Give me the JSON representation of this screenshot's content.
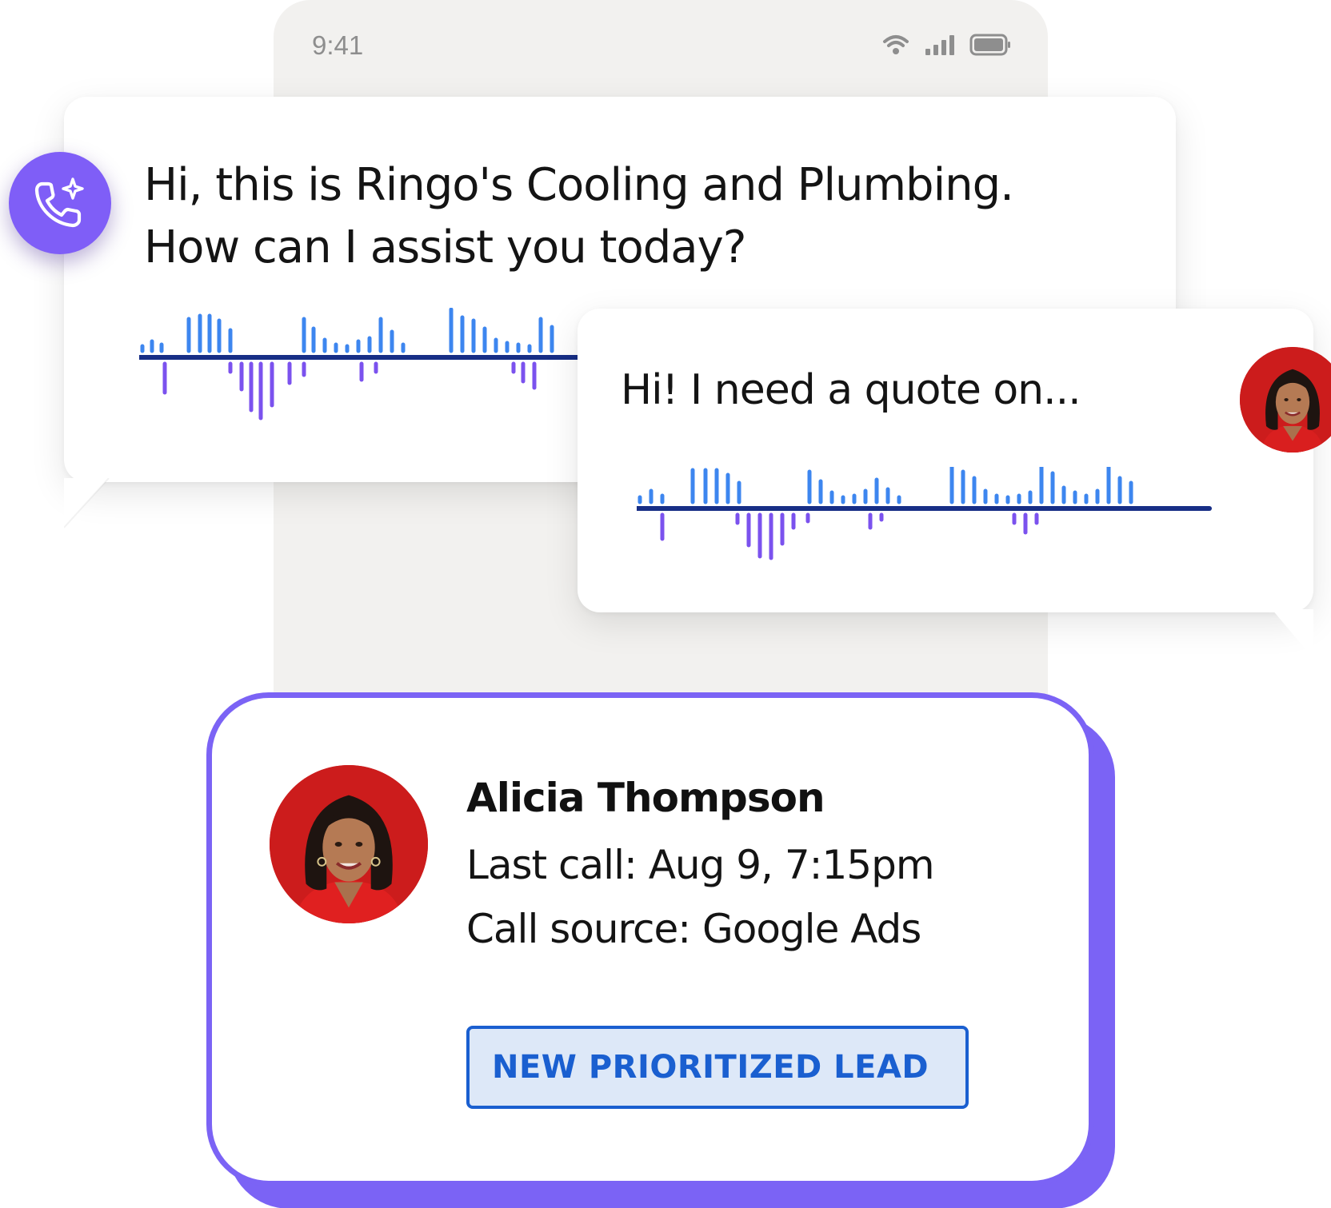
{
  "status_bar": {
    "time": "9:41",
    "icons": [
      "wifi-icon",
      "signal-icon",
      "battery-icon"
    ]
  },
  "agent_message": {
    "text": "Hi, this is Ringo's Cooling and Plumbing. How can I assist you today?",
    "icon": "ai-phone-icon"
  },
  "caller_message": {
    "text": "Hi! I need a quote on..."
  },
  "lead": {
    "name": "Alicia Thompson",
    "last_call": "Last call: Aug 9, 7:15pm",
    "call_source": "Call source: Google Ads",
    "badge": "NEW PRIORITIZED LEAD"
  },
  "colors": {
    "brand_purple": "#7b63f5",
    "wave_blue": "#3d86ef",
    "wave_purple": "#7b52ee",
    "wave_axis": "#172e86",
    "badge_blue": "#1a5fd0",
    "badge_bg": "#dde8f8",
    "avatar_bg": "#cc1c1c"
  }
}
